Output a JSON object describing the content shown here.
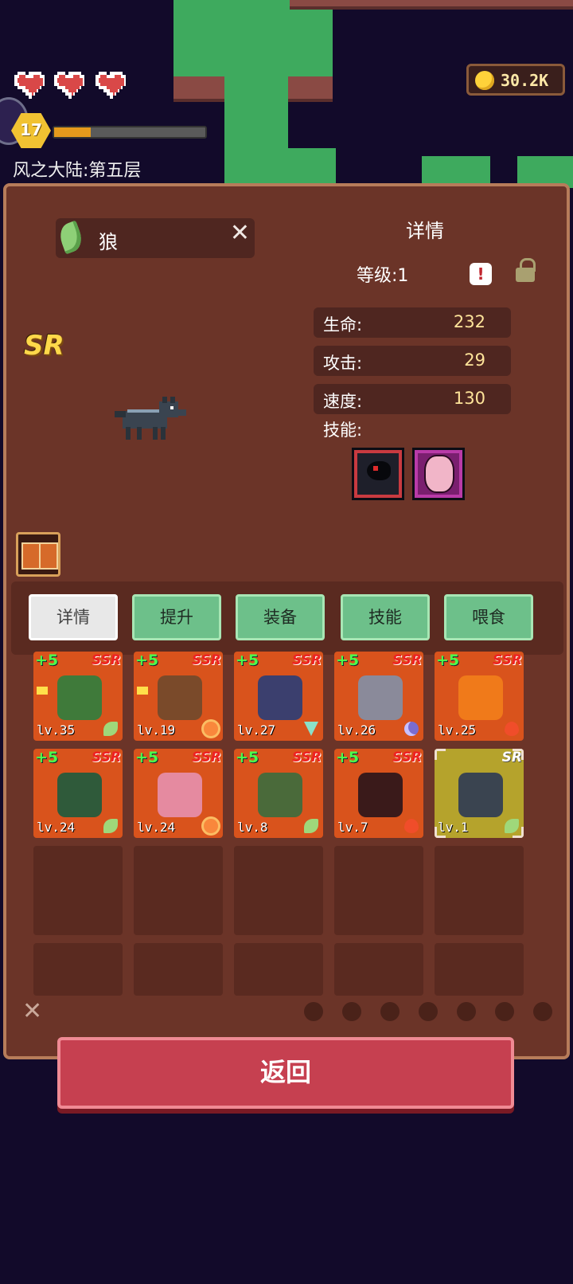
{
  "hud": {
    "hearts": 3,
    "coins": "30.2K",
    "player_level": "17",
    "xp_fraction": 0.24,
    "stage": "风之大陆:第五层"
  },
  "detail": {
    "pet_name": "狼",
    "close_glyph": "✕",
    "title": "详情",
    "level": "等级:1",
    "rarity": "SR",
    "stats": [
      {
        "label": "生命:",
        "value": "232"
      },
      {
        "label": "攻击:",
        "value": "29"
      },
      {
        "label": "速度:",
        "value": "130"
      }
    ],
    "skills_label": "技能:",
    "skill_icons": [
      "raven-skill-icon",
      "mask-skill-icon"
    ]
  },
  "tabs": [
    {
      "label": "详情",
      "active": true
    },
    {
      "label": "提升",
      "active": false
    },
    {
      "label": "装备",
      "active": false
    },
    {
      "label": "技能",
      "active": false
    },
    {
      "label": "喂食",
      "active": false
    }
  ],
  "roster": [
    {
      "plus": "+5",
      "rarity": "SSR",
      "level": "lv.35",
      "element": "leaf",
      "color": "#3f7a3a",
      "flag": true
    },
    {
      "plus": "+5",
      "rarity": "SSR",
      "level": "lv.19",
      "element": "sun",
      "color": "#7a4a2a",
      "flag": true
    },
    {
      "plus": "+5",
      "rarity": "SSR",
      "level": "lv.27",
      "element": "wind",
      "color": "#3b3f6e",
      "flag": false
    },
    {
      "plus": "+5",
      "rarity": "SSR",
      "level": "lv.26",
      "element": "moon",
      "color": "#8a8a9a",
      "flag": false
    },
    {
      "plus": "+5",
      "rarity": "SSR",
      "level": "lv.25",
      "element": "fire",
      "color": "#f07a1a",
      "flag": false
    },
    {
      "plus": "+5",
      "rarity": "SSR",
      "level": "lv.24",
      "element": "leaf",
      "color": "#2f5a3a",
      "flag": false
    },
    {
      "plus": "+5",
      "rarity": "SSR",
      "level": "lv.24",
      "element": "sun",
      "color": "#e58aa0",
      "flag": false
    },
    {
      "plus": "+5",
      "rarity": "SSR",
      "level": "lv.8",
      "element": "leaf",
      "color": "#4a6a3a",
      "flag": false
    },
    {
      "plus": "+5",
      "rarity": "SSR",
      "level": "lv.7",
      "element": "fire",
      "color": "#3a1a1a",
      "flag": false
    },
    {
      "plus": "",
      "rarity": "SR",
      "level": "lv.1",
      "element": "leaf",
      "color": "#3a4450",
      "flag": false,
      "selected": true
    }
  ],
  "empty_slots": 10,
  "filter_close": "✕",
  "return_label": "返回"
}
